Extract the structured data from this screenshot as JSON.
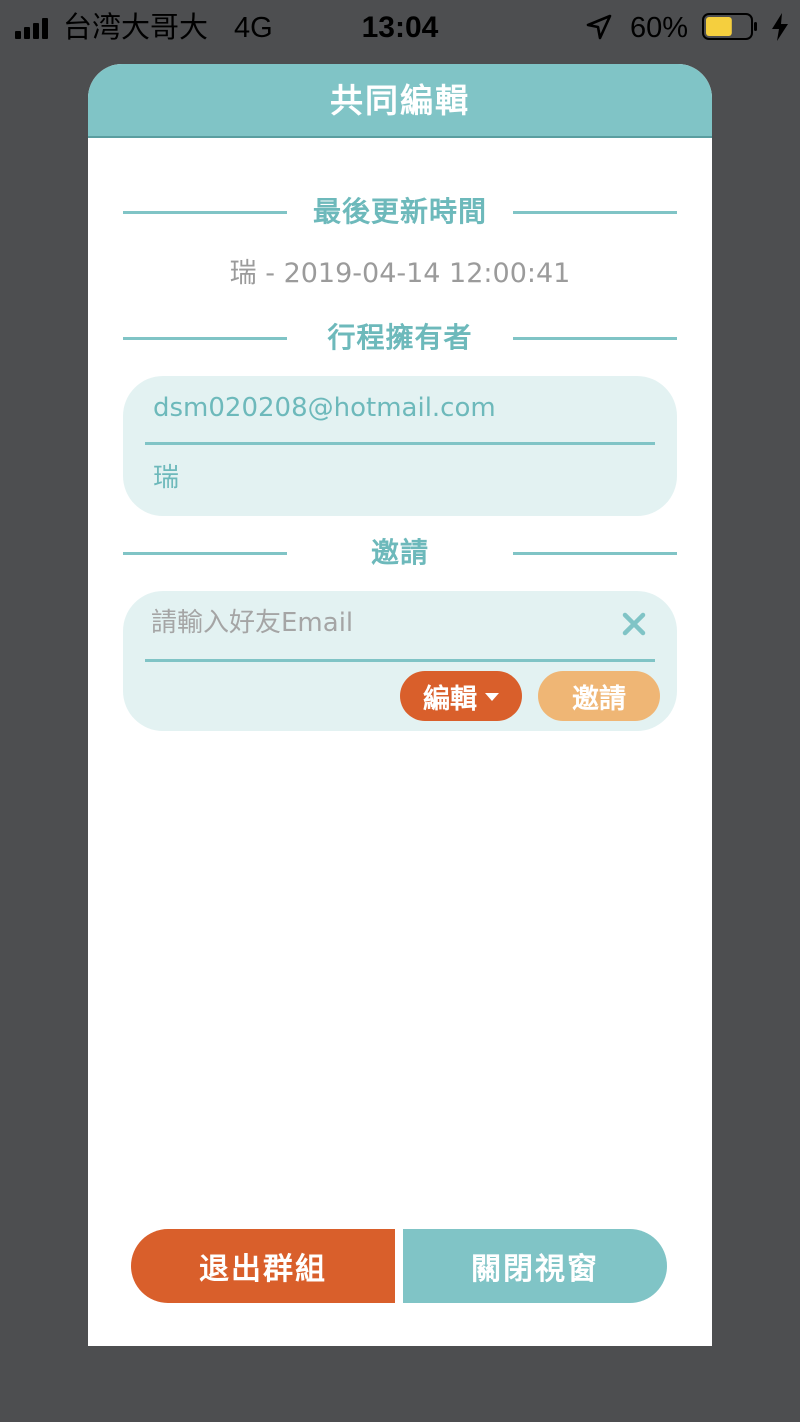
{
  "status_bar": {
    "carrier": "台湾大哥大",
    "network": "4G",
    "time": "13:04",
    "battery_percent": "60%",
    "battery_level": 0.6,
    "icons": [
      "signal-icon",
      "location-arrow-icon",
      "battery-icon",
      "charging-bolt-icon"
    ]
  },
  "dialog": {
    "title": "共同編輯",
    "last_update": {
      "heading": "最後更新時間",
      "info": "瑞 - 2019-04-14 12:00:41"
    },
    "owner": {
      "heading": "行程擁有者",
      "email": "dsm020208@hotmail.com",
      "name": "瑞"
    },
    "invite": {
      "heading": "邀請",
      "email_placeholder": "請輸入好友Email",
      "email_value": "",
      "permission_label": "編輯",
      "invite_label": "邀請"
    },
    "footer": {
      "leave_label": "退出群組",
      "close_label": "關閉視窗"
    }
  },
  "colors": {
    "teal": "#80c4c6",
    "teal_text": "#6db9bb",
    "card_bg": "#e3f2f2",
    "orange": "#d95f2b",
    "light_orange": "#efb675",
    "backdrop": "#4d4e50"
  }
}
